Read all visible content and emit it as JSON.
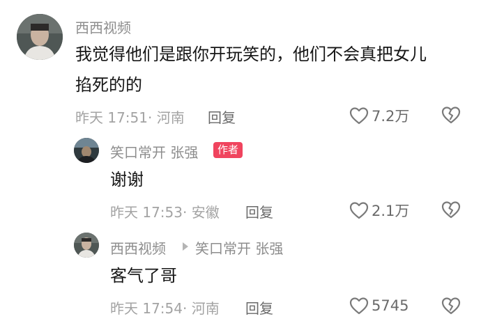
{
  "comments": [
    {
      "author": "西西视频",
      "text_line1": "我觉得他们是跟你开玩笑的，他们不会真把女儿",
      "text_line2": "掐死的的",
      "time": "昨天 17:51",
      "location": "河南",
      "reply_label": "回复",
      "likes": "7.2万"
    },
    {
      "author": "笑口常开 张强",
      "badge": "作者",
      "text": "谢谢",
      "time": "昨天 17:53",
      "location": "安徽",
      "reply_label": "回复",
      "likes": "2.1万"
    },
    {
      "author": "西西视频",
      "reply_to": "笑口常开 张强",
      "text": "客气了哥",
      "time": "昨天 17:54",
      "location": "河南",
      "reply_label": "回复",
      "likes": "5745"
    }
  ],
  "icons": {
    "like": "heart-outline-icon",
    "dislike": "broken-heart-icon",
    "reply_arrow": "play-triangle-icon"
  },
  "colors": {
    "badge": "#f0445e",
    "meta_text": "#a3a3a3",
    "name_text": "#8d8d8d"
  }
}
